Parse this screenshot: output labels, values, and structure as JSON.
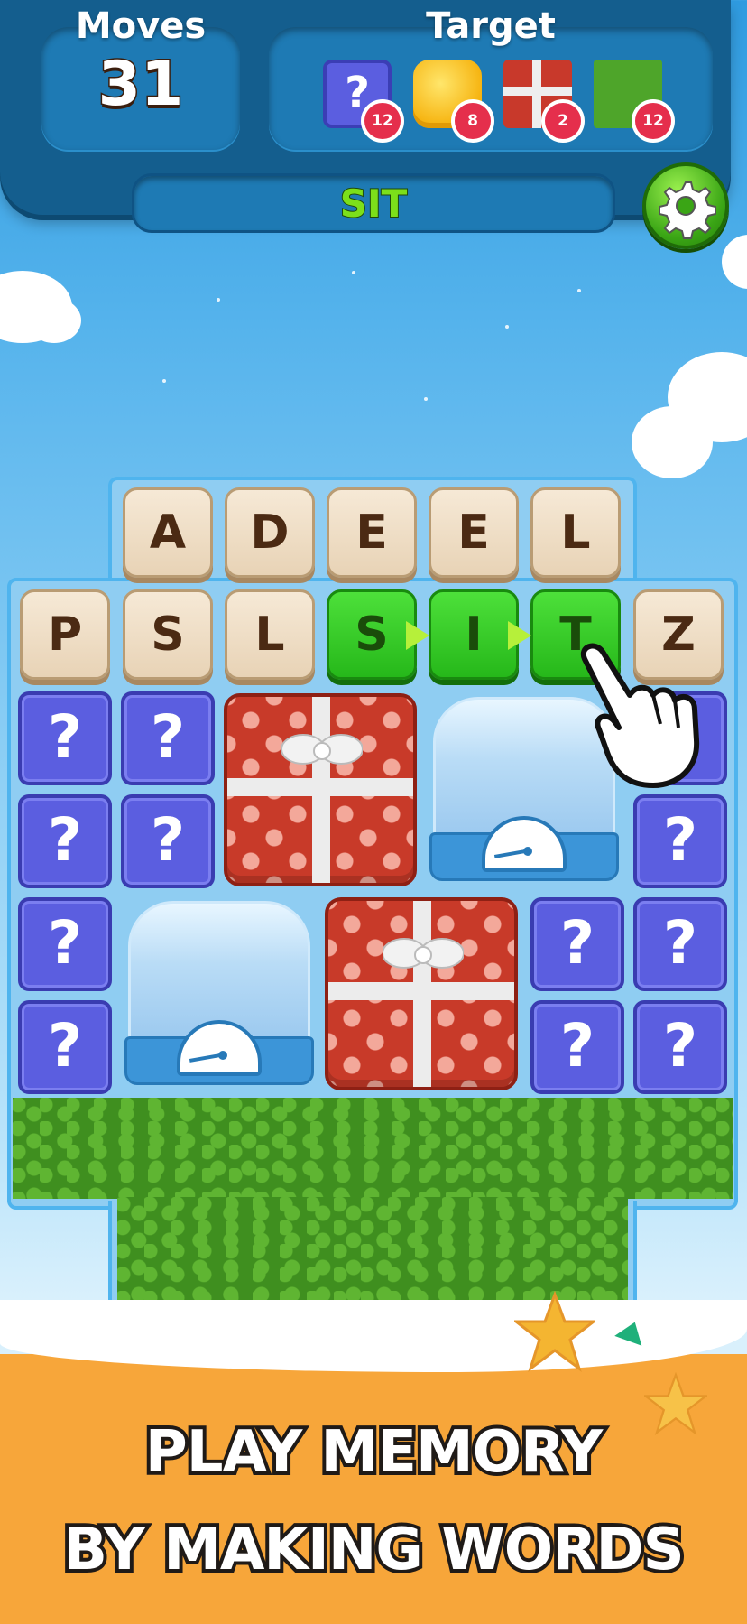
{
  "hud": {
    "moves_label": "Moves",
    "moves_value": "31",
    "target_label": "Target",
    "targets": [
      {
        "icon": "question-tile",
        "count": "12"
      },
      {
        "icon": "jelly-block",
        "count": "8"
      },
      {
        "icon": "gift-box",
        "count": "2"
      },
      {
        "icon": "grass-tile",
        "count": "12"
      }
    ],
    "current_word": "SIT",
    "settings_icon": "gear-icon"
  },
  "board": {
    "row1": [
      "A",
      "D",
      "E",
      "E",
      "L"
    ],
    "row2": [
      "P",
      "S",
      "L",
      "S",
      "I",
      "T",
      "Z"
    ],
    "selected_letters": [
      "S",
      "I",
      "T"
    ],
    "question_mark": "?"
  },
  "promo": {
    "line1": "PLAY MEMORY",
    "line2": "BY MAKING WORDS"
  },
  "colors": {
    "header": "#145e8e",
    "selected_tile": "#26b81a",
    "question_tile": "#5b5ee0",
    "badge": "#e52f4c",
    "sand": "#f7a63a"
  }
}
